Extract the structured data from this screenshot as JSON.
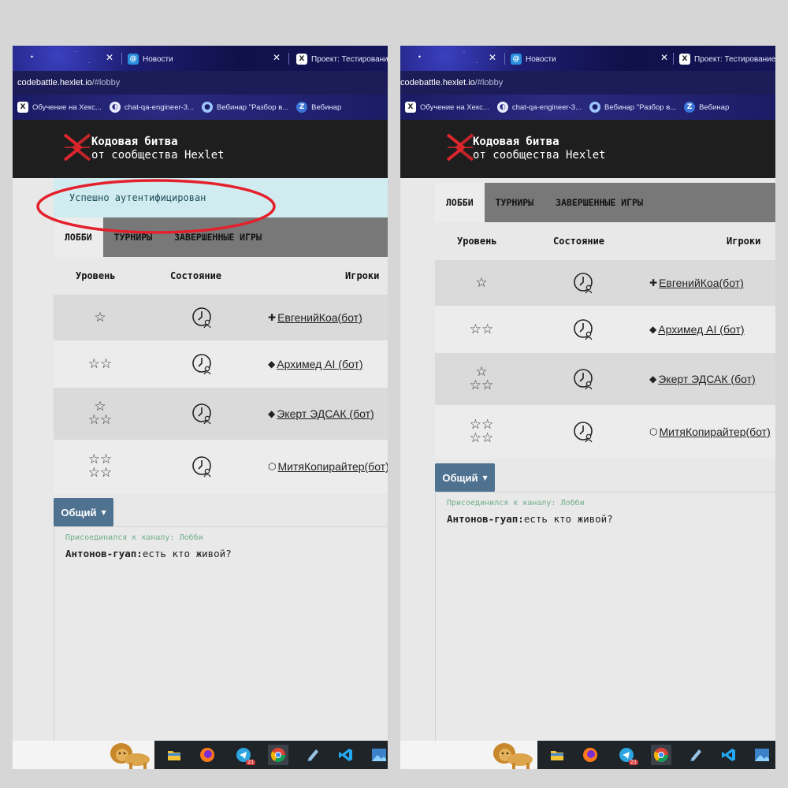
{
  "browser": {
    "tabs": [
      {
        "label": "Новости",
        "favicon": "news-icon"
      },
      {
        "label": "Проект: Тестирование",
        "favicon": "hexlet-icon"
      }
    ],
    "url_host": "codebattle.hexlet.io",
    "url_path": "/#lobby",
    "url_path_b": "/#lobby",
    "bookmarks": [
      {
        "label": "Обучение на Хекс...",
        "icon": "hexlet-icon"
      },
      {
        "label": "chat-qa-engineer-3...",
        "icon": "chat-icon"
      },
      {
        "label": "Вебинар \"Разбор в...",
        "icon": "globe-icon"
      },
      {
        "label": "Вебинар",
        "icon": "zoom-icon"
      }
    ]
  },
  "site": {
    "logo_line1": "Кодовая битва",
    "logo_line2": "от сообщества Hexlet"
  },
  "alert": {
    "text": "Успешно аутентифицирован"
  },
  "annotation_color": "#e4202c",
  "lobby": {
    "tabs": [
      "ЛОББИ",
      "ТУРНИРЫ",
      "ЗАВЕРШЕННЫЕ ИГРЫ"
    ],
    "active_tab": 0,
    "columns": [
      "Уровень",
      "Состояние",
      "Игроки"
    ],
    "rows": [
      {
        "level": 1,
        "stars": "☆",
        "stars2": "",
        "state": "waiting-clock-icon",
        "player_icon": "✚",
        "player": "ЕвгенийКоа(бот)"
      },
      {
        "level": 2,
        "stars": "☆☆",
        "stars2": "",
        "state": "waiting-clock-icon",
        "player_icon": "◆",
        "player": "Архимед AI (бот)"
      },
      {
        "level": 3,
        "stars": "☆",
        "stars2": "☆☆",
        "state": "waiting-clock-icon",
        "player_icon": "◆",
        "player": "Экерт ЭДСАК (бот)"
      },
      {
        "level": 4,
        "stars": "☆☆",
        "stars2": "☆☆",
        "state": "waiting-clock-icon",
        "player_icon": "⬡",
        "player": "МитяКопирайтер(бот)"
      }
    ]
  },
  "chat": {
    "channel_button": "Общий",
    "system_message": "Присоединился к каналу: Лобби",
    "messages": [
      {
        "author": "Антонов-гуап:",
        "text": "есть кто живой?"
      }
    ]
  },
  "taskbar": {
    "icons": [
      "files-icon",
      "firefox-icon",
      "telegram-icon",
      "chrome-icon",
      "notes-icon",
      "vscode-icon",
      "photos-icon"
    ],
    "telegram_badge": "21"
  }
}
